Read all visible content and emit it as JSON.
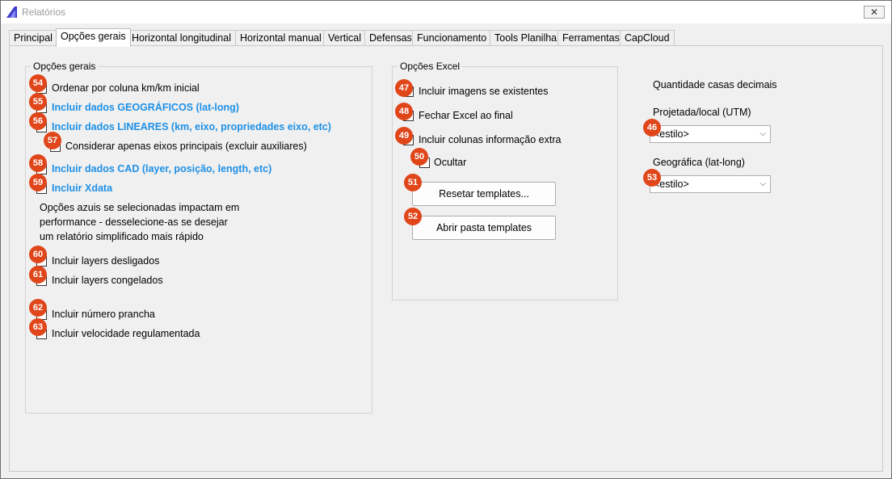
{
  "window": {
    "title": "Relatórios",
    "close_glyph": "✕"
  },
  "tabs": [
    "Principal",
    "Opções gerais",
    "Horizontal longitudinal",
    "Horizontal manual",
    "Vertical",
    "Defensas",
    "Funcionamento",
    "Tools Planilha",
    "Ferramentas",
    "CapCloud"
  ],
  "general": {
    "legend": "Opções gerais",
    "options": {
      "ordenar": "Ordenar por coluna km/km inicial",
      "geo": "Incluir dados GEOGRÁFICOS (lat-long)",
      "lineares": "Incluir dados LINEARES  (km, eixo, propriedades eixo, etc)",
      "eixos": "Considerar apenas eixos principais (excluir auxiliares)",
      "cad": "Incluir dados CAD (layer, posição, length, etc)",
      "xdata": "Incluir Xdata",
      "desligados": "Incluir layers desligados",
      "congelados": "Incluir layers congelados",
      "prancha": "Incluir número prancha",
      "velocidade": "Incluir velocidade regulamentada"
    },
    "note": "Opções azuis se selecionadas impactam em performance - desselecione-as se desejar um relatório simplificado mais rápido"
  },
  "excel": {
    "legend": "Opções Excel",
    "options": {
      "imagens": "Incluir imagens se existentes",
      "fechar": "Fechar Excel ao final",
      "colunas": "Incluir colunas informação extra",
      "ocultar": "Ocultar"
    },
    "reset_button": "Resetar templates...",
    "open_button": "Abrir pasta templates"
  },
  "decimals": {
    "heading": "Quantidade casas decimais",
    "projected_label": "Projetada/local (UTM)",
    "projected_value": "<estilo>",
    "geographic_label": "Geográfica (lat-long)",
    "geographic_value": "<estilo>"
  },
  "badges": {
    "b46": "46",
    "b47": "47",
    "b48": "48",
    "b49": "49",
    "b50": "50",
    "b51": "51",
    "b52": "52",
    "b53": "53",
    "b54": "54",
    "b55": "55",
    "b56": "56",
    "b57": "57",
    "b58": "58",
    "b59": "59",
    "b60": "60",
    "b61": "61",
    "b62": "62",
    "b63": "63"
  },
  "colors": {
    "badge": "#e0461a",
    "blue_option": "#1e90e6"
  }
}
